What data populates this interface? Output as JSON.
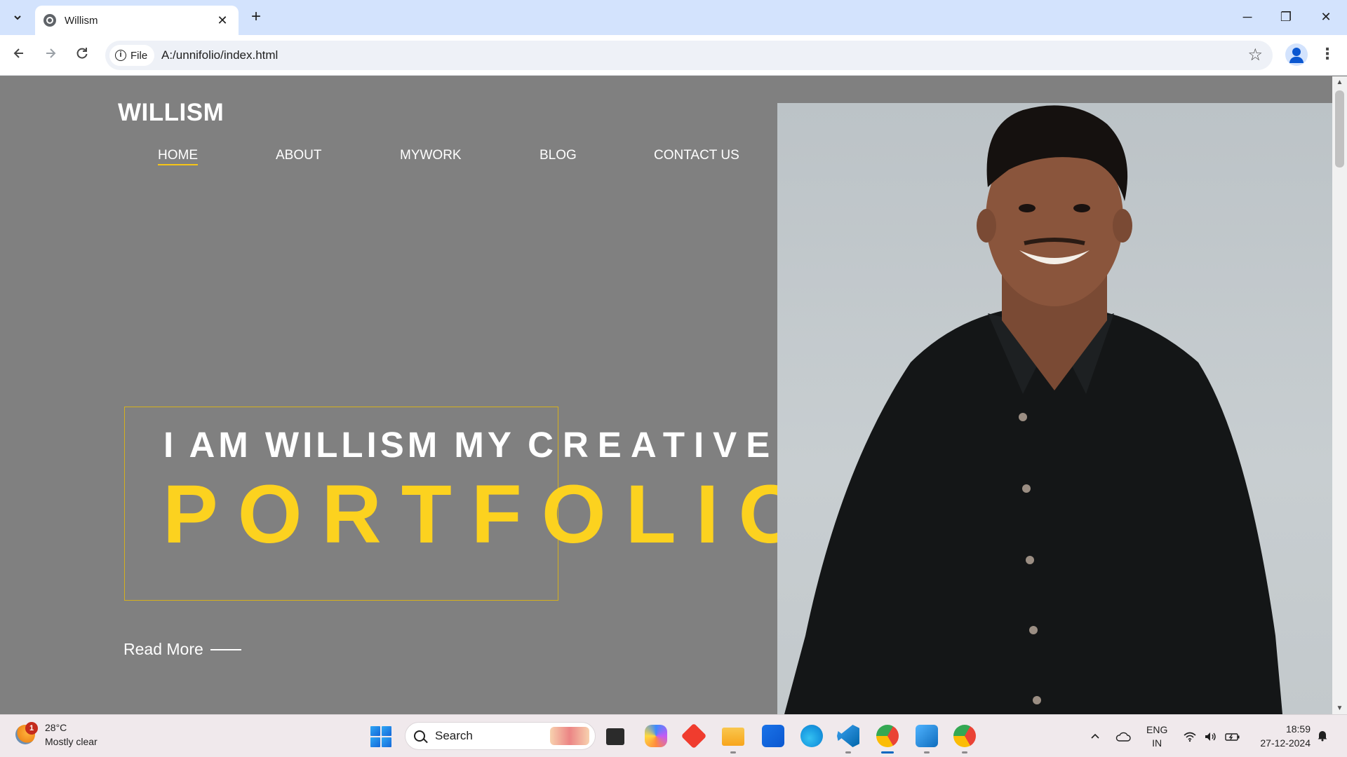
{
  "browser": {
    "tab_title": "Willism",
    "site_chip_label": "File",
    "url": "A:/unnifolio/index.html"
  },
  "site": {
    "logo": "WILLISM",
    "nav": [
      "HOME",
      "ABOUT",
      "MYWORK",
      "BLOG",
      "CONTACT US"
    ],
    "active_nav": "HOME",
    "hero_line1_plain": "I AM WILLISM MY ",
    "hero_line1_spaced": "CREATIVE",
    "hero_line2": "PORTFOLIO",
    "read_more": "Read More",
    "accent_color": "#fcd21f",
    "background_color": "#808080"
  },
  "taskbar": {
    "weather_temp": "28°C",
    "weather_desc": "Mostly clear",
    "weather_badge": "1",
    "search_placeholder": "Search",
    "language_line1": "ENG",
    "language_line2": "IN",
    "time": "18:59",
    "date": "27-12-2024",
    "pinned_apps": [
      "task-view",
      "copilot",
      "git",
      "file-explorer",
      "microsoft-store",
      "edge",
      "vs-code",
      "chrome",
      "photos",
      "chrome"
    ]
  }
}
